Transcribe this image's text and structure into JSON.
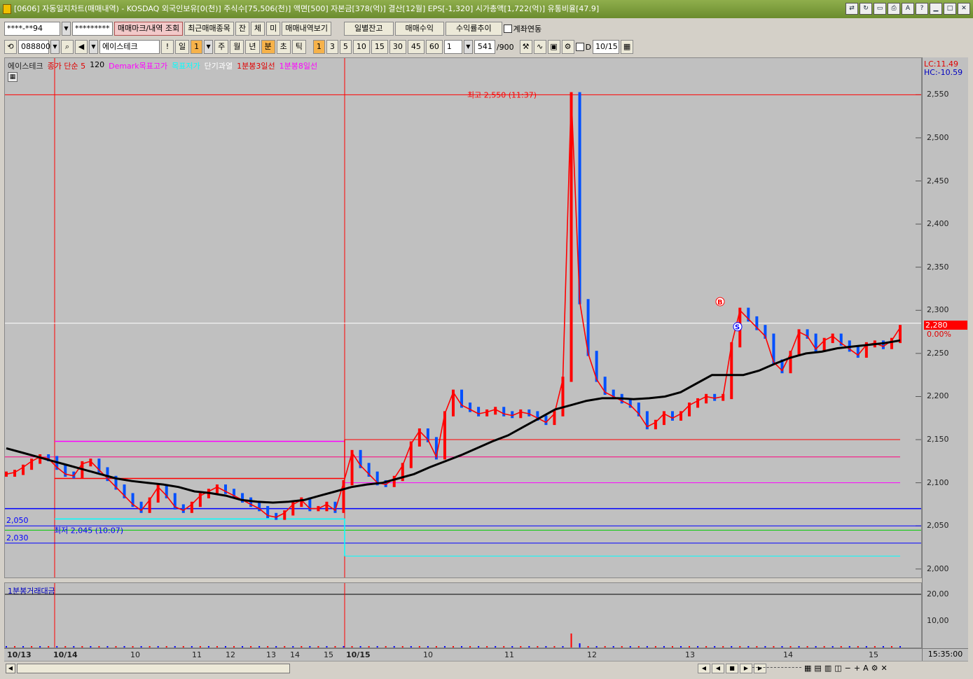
{
  "window": {
    "title": "[0606] 자동일지차트(매매내역) - KOSDAQ 외국인보유[0(천)] 주식수[75,506(천)] 액면[500] 자본금[378(억)] 결산[12월] EPS[-1,320] 시가총액[1,722(억)] 유통비율[47.9]"
  },
  "toolbar1": {
    "account": "****-**94",
    "password": "*********",
    "btn_mark": "매매마크/내역 조회",
    "btn_recent": "최근매매종목",
    "btn_jan": "잔",
    "btn_che": "체",
    "btn_mi": "미",
    "btn_view": "매매내역보기",
    "btn_daily": "일별잔고",
    "btn_profit": "매매수익",
    "btn_rate": "수익률추이",
    "chk_link": "계좌연동"
  },
  "toolbar2": {
    "code": "088800",
    "name": "에이스테크",
    "period_btns": [
      "일",
      "1",
      "주",
      "월",
      "년",
      "분",
      "초",
      "틱"
    ],
    "interval_btns": [
      "1",
      "3",
      "5",
      "10",
      "15",
      "30",
      "45",
      "60"
    ],
    "interval_input": "1",
    "count": "541",
    "count_total": "/900",
    "chk_d": "D",
    "date": "10/15"
  },
  "legend": {
    "name": "에이스테크",
    "ma5": "종가 단순 5",
    "ma120": "120",
    "demark_high": "Demark목표고가",
    "demark_low": "목표저가",
    "short_overheat": "단기과열",
    "line3": "1분봉3일선",
    "line8": "1분봉8일선",
    "volume_label": "1분봉거래대금"
  },
  "axis_info": {
    "lc": "LC:11.49",
    "hc": "HC:-10.59",
    "current_price": "2,280",
    "current_change": "0.00%",
    "time": "15:35:00"
  },
  "annotations": {
    "high": "최고 2,550 (11:37)",
    "low": "최저 2,045 (10:07)",
    "left_2050": "2,050",
    "left_2030": "2,030",
    "buy_mark": "B",
    "sell_mark": "S"
  },
  "colors": {
    "up": "#ff0000",
    "down": "#0000ff",
    "ma120": "#000000",
    "magenta": "#ff00ff",
    "cyan": "#00ffff",
    "bg": "#c0c0c0"
  },
  "chart_data": {
    "type": "line",
    "title": "에이스테크 1분봉",
    "ylim": [
      1995,
      2560
    ],
    "y_ticks": [
      "2,550",
      "2,500",
      "2,450",
      "2,400",
      "2,350",
      "2,300",
      "2,250",
      "2,200",
      "2,150",
      "2,100",
      "2,050",
      "2,000"
    ],
    "volume_ticks": [
      "20,00",
      "10,00"
    ],
    "x_ticks": [
      "10/13",
      "10/14",
      "10",
      "11",
      "12",
      "13",
      "14",
      "15",
      "10/15",
      "10",
      "11",
      "12",
      "13",
      "14",
      "15"
    ],
    "series": [
      {
        "name": "종가",
        "values": [
          2110,
          2112,
          2118,
          2125,
          2130,
          2128,
          2118,
          2110,
          2108,
          2122,
          2125,
          2115,
          2105,
          2095,
          2085,
          2075,
          2068,
          2080,
          2095,
          2085,
          2072,
          2068,
          2075,
          2085,
          2090,
          2095,
          2090,
          2085,
          2080,
          2075,
          2070,
          2062,
          2060,
          2065,
          2075,
          2080,
          2070,
          2070,
          2075,
          2068,
          2100,
          2135,
          2120,
          2110,
          2100,
          2098,
          2105,
          2120,
          2145,
          2160,
          2150,
          2130,
          2180,
          2205,
          2190,
          2185,
          2180,
          2182,
          2185,
          2180,
          2178,
          2182,
          2180,
          2175,
          2170,
          2180,
          2220,
          2550,
          2310,
          2250,
          2220,
          2205,
          2200,
          2195,
          2190,
          2180,
          2165,
          2170,
          2180,
          2175,
          2180,
          2190,
          2195,
          2200,
          2198,
          2200,
          2260,
          2300,
          2290,
          2280,
          2270,
          2240,
          2230,
          2250,
          2275,
          2270,
          2255,
          2265,
          2270,
          2262,
          2255,
          2248,
          2260,
          2262,
          2258,
          2265,
          2280
        ]
      },
      {
        "name": "120",
        "values": [
          2140,
          2135,
          2130,
          2125,
          2120,
          2115,
          2110,
          2105,
          2102,
          2100,
          2098,
          2095,
          2090,
          2088,
          2085,
          2080,
          2078,
          2077,
          2078,
          2080,
          2085,
          2090,
          2095,
          2098,
          2100,
          2105,
          2110,
          2118,
          2125,
          2132,
          2140,
          2148,
          2155,
          2165,
          2175,
          2185,
          2190,
          2195,
          2198,
          2198,
          2197,
          2198,
          2200,
          2205,
          2215,
          2225,
          2225,
          2225,
          2230,
          2238,
          2245,
          2250,
          2252,
          2256,
          2258,
          2260,
          2262,
          2265
        ]
      }
    ],
    "reference_levels": [
      {
        "name": "최고",
        "value": 2550
      },
      {
        "name": "최저",
        "value": 2045
      },
      {
        "value": 2150
      },
      {
        "value": 2130
      },
      {
        "value": 2100
      },
      {
        "value": 2070
      },
      {
        "value": 2050
      },
      {
        "value": 2030
      },
      {
        "value": 2015
      }
    ]
  },
  "scrollbar": {
    "right_controls": [
      "◀",
      "◀",
      "■",
      "▶",
      "▶"
    ]
  }
}
